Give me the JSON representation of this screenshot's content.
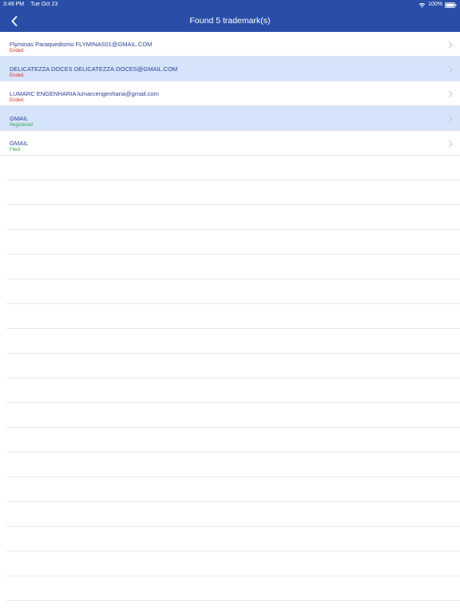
{
  "status_bar": {
    "time": "3:49 PM",
    "date": "Tue Oct 23",
    "battery": "100%"
  },
  "nav": {
    "title": "Found 5 trademark(s)",
    "back_icon": "chevron-left-icon"
  },
  "colors": {
    "nav_background": "#2a4ea8",
    "highlight_row": "#d6e4fb",
    "title_text": "#2a3f9a",
    "status_ended": "#d9302c",
    "status_registered": "#2ea84a",
    "status_filed": "#2ea84a"
  },
  "results": [
    {
      "title": "Flyminas Paraquedismo FLYMINAS01@GMAIL.COM",
      "status": "Ended",
      "status_color": "#d9302c",
      "highlighted": false
    },
    {
      "title": "DELICATEZZA DOCES DELICATEZZA.DOCES@GMAIL.COM",
      "status": "Ended",
      "status_color": "#d9302c",
      "highlighted": true
    },
    {
      "title": "LUMARC ENGENHARIA lumarcengenharia@gmail.com",
      "status": "Ended",
      "status_color": "#d9302c",
      "highlighted": false
    },
    {
      "title": "GMAIL",
      "status": "Registered",
      "status_color": "#2ea84a",
      "highlighted": true
    },
    {
      "title": "GMAIL",
      "status": "Filed",
      "status_color": "#2ea84a",
      "highlighted": false
    }
  ]
}
